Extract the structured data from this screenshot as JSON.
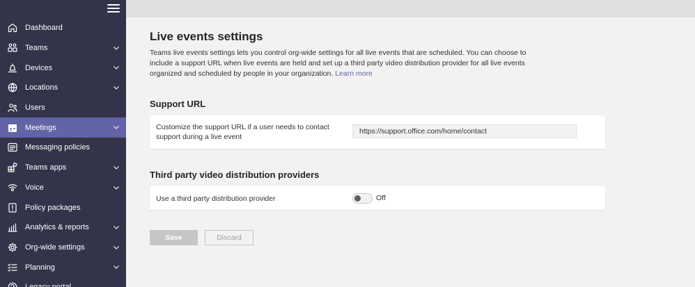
{
  "sidebar": {
    "items": [
      {
        "label": "Dashboard",
        "icon": "home-icon",
        "chevron": false,
        "active": false
      },
      {
        "label": "Teams",
        "icon": "teams-icon",
        "chevron": true,
        "active": false
      },
      {
        "label": "Devices",
        "icon": "bell-icon",
        "chevron": true,
        "active": false
      },
      {
        "label": "Locations",
        "icon": "globe-icon",
        "chevron": true,
        "active": false
      },
      {
        "label": "Users",
        "icon": "users-icon",
        "chevron": false,
        "active": false
      },
      {
        "label": "Meetings",
        "icon": "calendar-icon",
        "chevron": true,
        "active": true
      },
      {
        "label": "Messaging policies",
        "icon": "chat-icon",
        "chevron": false,
        "active": false
      },
      {
        "label": "Teams apps",
        "icon": "apps-icon",
        "chevron": true,
        "active": false
      },
      {
        "label": "Voice",
        "icon": "voice-icon",
        "chevron": true,
        "active": false
      },
      {
        "label": "Policy packages",
        "icon": "package-icon",
        "chevron": false,
        "active": false
      },
      {
        "label": "Analytics & reports",
        "icon": "analytics-icon",
        "chevron": true,
        "active": false
      },
      {
        "label": "Org-wide settings",
        "icon": "gear-icon",
        "chevron": true,
        "active": false
      },
      {
        "label": "Planning",
        "icon": "checklist-icon",
        "chevron": true,
        "active": false
      },
      {
        "label": "Legacy portal",
        "icon": "legacy-icon",
        "chevron": false,
        "active": false
      }
    ]
  },
  "main": {
    "title": "Live events settings",
    "description": "Teams live events settings lets you control org-wide settings for all live events that are scheduled. You can choose to include a support URL when live events are held and set up a third party video distribution provider for all live events organized and scheduled by people in your organization. ",
    "learn_more": "Learn more",
    "support_section": {
      "heading": "Support URL",
      "label": "Customize the support URL if a user needs to contact support during a live event",
      "url_value": "https://support.office.com/home/contact"
    },
    "provider_section": {
      "heading": "Third party video distribution providers",
      "label": "Use a third party distribution provider",
      "toggle_state": "Off"
    },
    "buttons": {
      "save": "Save",
      "discard": "Discard"
    }
  },
  "colors": {
    "sidebar_bg": "#33344a",
    "active_bg": "#6264a7",
    "accent": "#6264a7"
  }
}
